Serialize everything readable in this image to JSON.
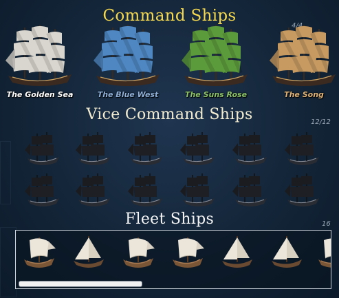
{
  "command": {
    "title": "Command Ships",
    "count": "4/4",
    "ships": [
      {
        "name": "The Golden Sea",
        "sail_color": "#d9d6cf",
        "label_color": "#ffffff"
      },
      {
        "name": "The Blue West",
        "sail_color": "#4f87c2",
        "label_color": "#8fb1da"
      },
      {
        "name": "The Suns Rose",
        "sail_color": "#5c9b3c",
        "label_color": "#8cc36a"
      },
      {
        "name": "The Song",
        "sail_color": "#c79a62",
        "label_color": "#e0b478"
      }
    ]
  },
  "vice": {
    "title": "Vice Command Ships",
    "count": "12/12"
  },
  "fleet": {
    "title": "Fleet Ships",
    "count": "16",
    "scroll_fraction": 0.4
  },
  "colors": {
    "title_gold": "#f5d84e",
    "title_cream": "#f3ecd0",
    "title_white": "#f4f4f4"
  }
}
